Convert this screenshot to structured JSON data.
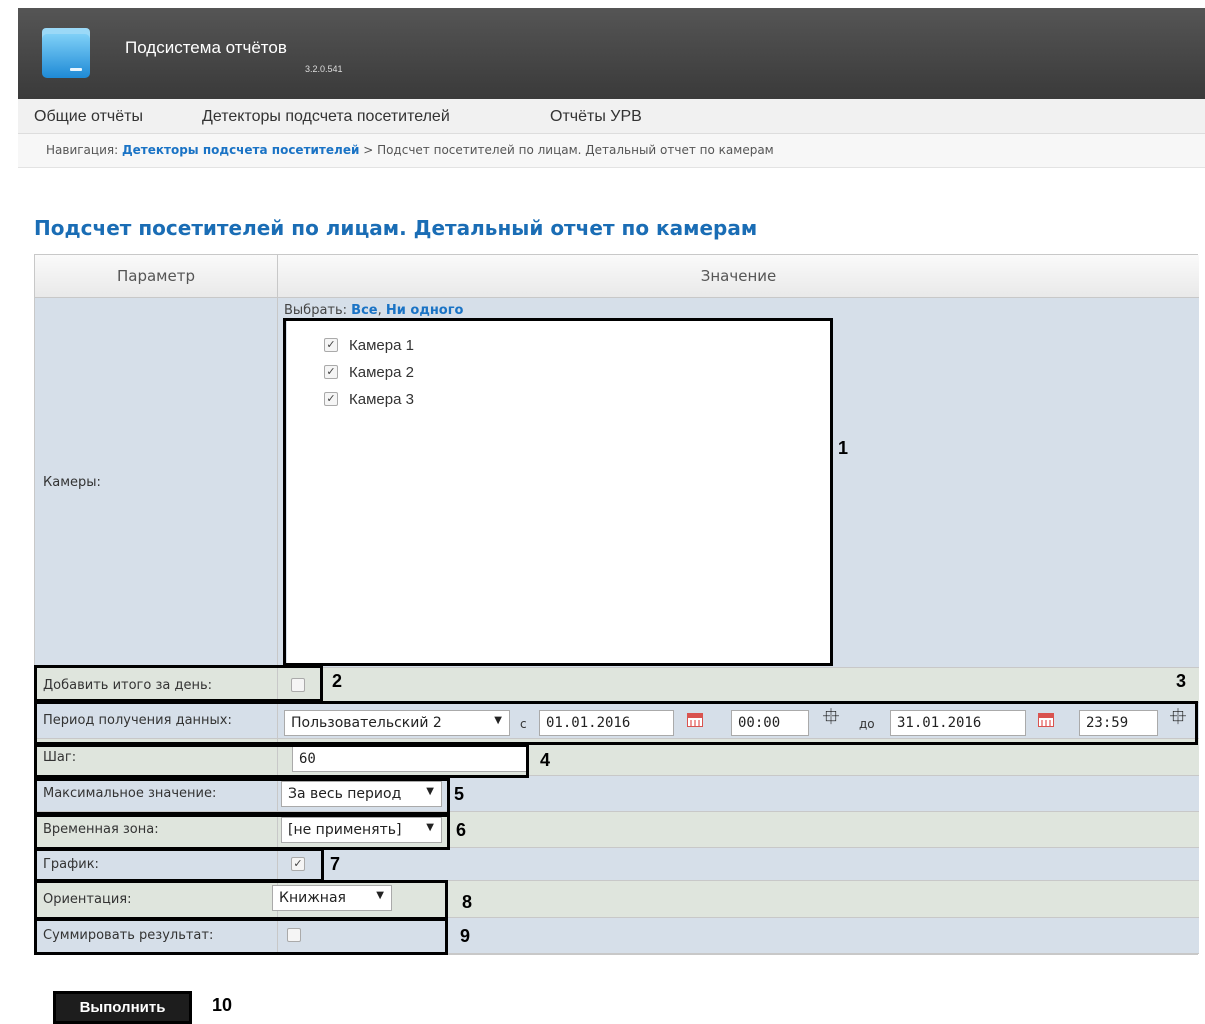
{
  "header": {
    "title": "Подсистема отчётов",
    "version": "3.2.0.541"
  },
  "menu": {
    "items": [
      "Общие отчёты",
      "Детекторы подсчета посетителей",
      "Отчёты УРВ"
    ]
  },
  "breadcrumb": {
    "prefix": "Навигация: ",
    "link": "Детекторы подсчета посетителей",
    "separator": " > ",
    "current": "Подсчет посетителей по лицам. Детальный отчет по камерам"
  },
  "page": {
    "title": "Подсчет посетителей по лицам. Детальный отчет по камерам"
  },
  "table": {
    "col_param": "Параметр",
    "col_value": "Значение"
  },
  "cameras": {
    "label": "Камеры:",
    "select_prefix": "Выбрать: ",
    "select_all": "Все",
    "select_comma": ", ",
    "select_none": "Ни одного",
    "items": [
      {
        "name": "Камера 1",
        "checked": true
      },
      {
        "name": "Камера 2",
        "checked": true
      },
      {
        "name": "Камера 3",
        "checked": true
      }
    ]
  },
  "daily_total": {
    "label": "Добавить итого за день:",
    "checked": false
  },
  "period": {
    "label": "Период получения данных:",
    "preset": "Пользовательский 2",
    "from_label": "с",
    "from_date": "01.01.2016",
    "from_time": "00:00",
    "to_label": "до",
    "to_date": "31.01.2016",
    "to_time": "23:59"
  },
  "step": {
    "label": "Шаг:",
    "value": "60"
  },
  "max_value": {
    "label": "Максимальное значение:",
    "value": "За весь период"
  },
  "timezone": {
    "label": "Временная зона:",
    "value": "[не применять]"
  },
  "chart": {
    "label": "График:",
    "checked": true
  },
  "orientation": {
    "label": "Ориентация:",
    "value": "Книжная"
  },
  "summarize": {
    "label": "Суммировать результат:",
    "checked": false
  },
  "run_button": "Выполнить",
  "callouts": [
    "1",
    "2",
    "3",
    "4",
    "5",
    "6",
    "7",
    "8",
    "9",
    "10"
  ],
  "icons": {
    "app": "folder-icon",
    "calendar": "calendar-icon",
    "move": "move-icon",
    "dropdown": "chevron-down-icon"
  }
}
